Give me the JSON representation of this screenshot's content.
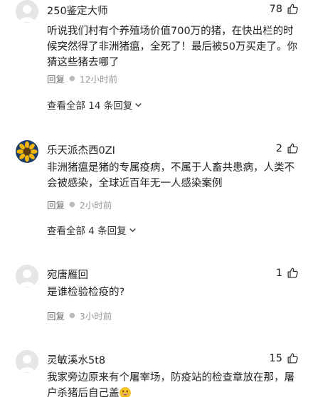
{
  "comments": [
    {
      "username": "250鉴定大师",
      "likes": "78",
      "text": "听说我们村有个养殖场价值700万的猪，在快出栏的时候突然得了非洲猪瘟，全死了！最后被50万买走了。你猜这些猪去哪了",
      "reply_label": "回复",
      "time": "12小时前",
      "view_replies": "查看全部 14 条回复",
      "avatar": "default-gray"
    },
    {
      "username": "乐天派杰西0ZI",
      "likes": "2",
      "text": "非洲猪瘟是猪的专属疫病，不属于人畜共患病，人类不会被感染，全球近百年无一人感染案例",
      "reply_label": "回复",
      "time": "2小时前",
      "view_replies": "查看全部 4 条回复",
      "avatar": "sunflower"
    },
    {
      "username": "宛唐雁回",
      "likes": "1",
      "text": "是谁检验检疫的?",
      "reply_label": "回复",
      "time": "3小时前",
      "avatar": "default-gray"
    },
    {
      "username": "灵敏溪水5t8",
      "likes": "15",
      "text": "我家旁边原来有个屠宰场，防疫站的检查章放在那，屠户杀猪后自己盖",
      "emoji": "grinning-face-emoji",
      "avatar": "default-gray"
    }
  ],
  "icons": {
    "like": "thumbs-up-icon",
    "expand": "chevron-down-icon"
  },
  "colors": {
    "text": "#222222",
    "meta": "#999999",
    "reply": "#666666",
    "avatar_bg": "#e6e6e6"
  }
}
